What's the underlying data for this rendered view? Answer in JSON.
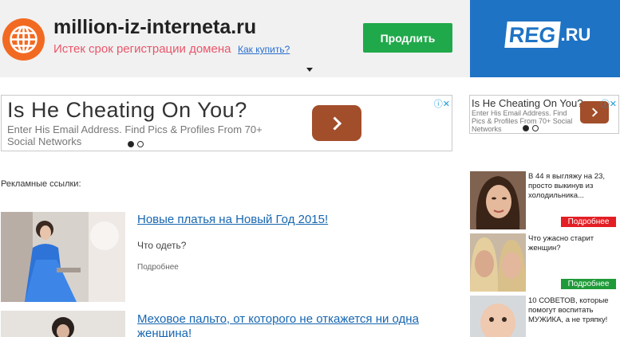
{
  "banner": {
    "domain": "million-iz-interneta.ru",
    "expired_text": "Истек срок регистрации домена",
    "how_to_buy": "Как купить?",
    "renew_button": "Продлить",
    "registrar_logo": "REG",
    "registrar_suffix": ".RU",
    "accent": "#20a94a",
    "registrar_color": "#1f73c4",
    "icon": "globe-icon"
  },
  "ad_main": {
    "title": "Is He Cheating On You?",
    "description": "Enter His Email Address. Find Pics & Profiles From 70+ Social Networks",
    "adchoices": "ⓘ✕"
  },
  "ad_side": {
    "title": "Is He Cheating On You?",
    "description": "Enter His Email Address. Find Pics & Profiles From 70+ Social Networks",
    "adchoices": "ⓘ✕"
  },
  "ads_label": "Рекламные ссылки:",
  "articles": [
    {
      "title": "Новые платья на Новый Год 2015!",
      "subtitle": "Что одеть?",
      "more": "Подробнее"
    },
    {
      "title": "Меховое пальто, от которого не откажется ни одна женщина!"
    }
  ],
  "teasers": [
    {
      "text": "В 44 я выгляжу на 23, просто выкинув из холодильника...",
      "button": "Подробнее",
      "button_color": "#e31e24"
    },
    {
      "text": "Что ужасно старит женщин?",
      "button": "Подробнее",
      "button_color": "#1f9a39"
    },
    {
      "text": "10 СОВЕТОВ, которые помогут воспитать МУЖИКА, а не тряпку!"
    }
  ]
}
